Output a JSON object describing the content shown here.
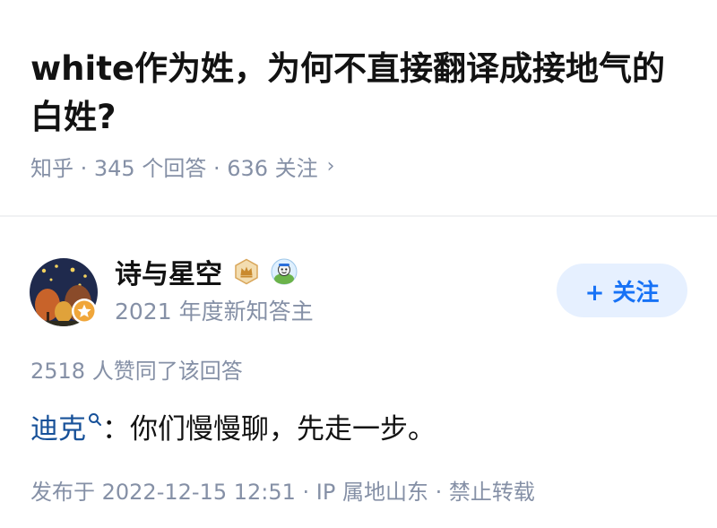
{
  "question": {
    "title": "white作为姓，为何不直接翻译成接地气的白姓?",
    "meta": "知乎 · 345 个回答 · 636 关注",
    "chevron": "›"
  },
  "author": {
    "name": "诗与星空",
    "subtitle": "2021 年度新知答主",
    "avatar_icon": "night-sky-avatar",
    "badges": [
      "golden-crown-icon",
      "cartoon-character-icon"
    ],
    "follow_label": "+ 关注"
  },
  "answer": {
    "vote_info": "2518 人赞同了该回答",
    "mention": "迪克",
    "content": "：你们慢慢聊，先走一步。",
    "meta": "发布于 2022-12-15 12:51 · IP 属地山东 · 禁止转载"
  },
  "colors": {
    "accent": "#1772f6",
    "link": "#175199",
    "muted": "#8590a6",
    "follow_bg": "#e6f0ff"
  }
}
